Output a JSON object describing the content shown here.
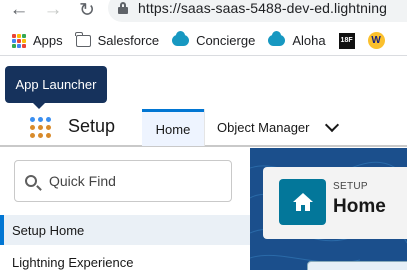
{
  "browser": {
    "url": "https://saas-saas-5488-dev-ed.lightning",
    "bookmarks": [
      {
        "label": "Apps",
        "icon": "apps-grid-icon"
      },
      {
        "label": "Salesforce",
        "icon": "folder-icon"
      },
      {
        "label": "Concierge",
        "icon": "salesforce-cloud-icon"
      },
      {
        "label": "Aloha",
        "icon": "salesforce-cloud-icon"
      },
      {
        "label": "",
        "icon": "18f-icon"
      },
      {
        "label": "",
        "icon": "w-icon"
      }
    ],
    "eighteenf_text": "18F",
    "w_text": "W"
  },
  "salesforce": {
    "tooltip": "App Launcher",
    "app_name": "Setup",
    "tabs": [
      {
        "label": "Home",
        "active": true
      },
      {
        "label": "Object Manager",
        "active": false
      }
    ],
    "quick_find_placeholder": "Quick Find",
    "nav_items": [
      {
        "label": "Setup Home",
        "active": true
      },
      {
        "label": "Lightning Experience",
        "active": false
      }
    ],
    "page_header": {
      "eyebrow": "SETUP",
      "title": "Home"
    },
    "colors": {
      "tooltip_bg": "#16325c",
      "brand_blue": "#0176d3",
      "home_tile": "#03779a",
      "right_panel": "#1b4f8c",
      "launcher_orange": "#d88b2b"
    }
  }
}
